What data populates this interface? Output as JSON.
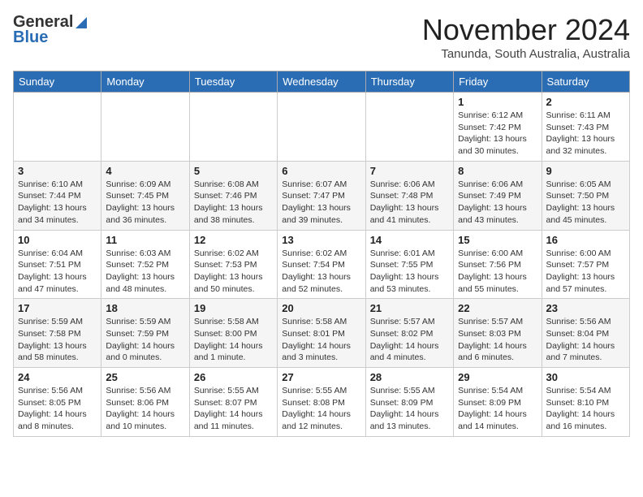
{
  "logo": {
    "general": "General",
    "blue": "Blue"
  },
  "title": "November 2024",
  "location": "Tanunda, South Australia, Australia",
  "days_of_week": [
    "Sunday",
    "Monday",
    "Tuesday",
    "Wednesday",
    "Thursday",
    "Friday",
    "Saturday"
  ],
  "weeks": [
    [
      {
        "day": "",
        "info": ""
      },
      {
        "day": "",
        "info": ""
      },
      {
        "day": "",
        "info": ""
      },
      {
        "day": "",
        "info": ""
      },
      {
        "day": "",
        "info": ""
      },
      {
        "day": "1",
        "info": "Sunrise: 6:12 AM\nSunset: 7:42 PM\nDaylight: 13 hours\nand 30 minutes."
      },
      {
        "day": "2",
        "info": "Sunrise: 6:11 AM\nSunset: 7:43 PM\nDaylight: 13 hours\nand 32 minutes."
      }
    ],
    [
      {
        "day": "3",
        "info": "Sunrise: 6:10 AM\nSunset: 7:44 PM\nDaylight: 13 hours\nand 34 minutes."
      },
      {
        "day": "4",
        "info": "Sunrise: 6:09 AM\nSunset: 7:45 PM\nDaylight: 13 hours\nand 36 minutes."
      },
      {
        "day": "5",
        "info": "Sunrise: 6:08 AM\nSunset: 7:46 PM\nDaylight: 13 hours\nand 38 minutes."
      },
      {
        "day": "6",
        "info": "Sunrise: 6:07 AM\nSunset: 7:47 PM\nDaylight: 13 hours\nand 39 minutes."
      },
      {
        "day": "7",
        "info": "Sunrise: 6:06 AM\nSunset: 7:48 PM\nDaylight: 13 hours\nand 41 minutes."
      },
      {
        "day": "8",
        "info": "Sunrise: 6:06 AM\nSunset: 7:49 PM\nDaylight: 13 hours\nand 43 minutes."
      },
      {
        "day": "9",
        "info": "Sunrise: 6:05 AM\nSunset: 7:50 PM\nDaylight: 13 hours\nand 45 minutes."
      }
    ],
    [
      {
        "day": "10",
        "info": "Sunrise: 6:04 AM\nSunset: 7:51 PM\nDaylight: 13 hours\nand 47 minutes."
      },
      {
        "day": "11",
        "info": "Sunrise: 6:03 AM\nSunset: 7:52 PM\nDaylight: 13 hours\nand 48 minutes."
      },
      {
        "day": "12",
        "info": "Sunrise: 6:02 AM\nSunset: 7:53 PM\nDaylight: 13 hours\nand 50 minutes."
      },
      {
        "day": "13",
        "info": "Sunrise: 6:02 AM\nSunset: 7:54 PM\nDaylight: 13 hours\nand 52 minutes."
      },
      {
        "day": "14",
        "info": "Sunrise: 6:01 AM\nSunset: 7:55 PM\nDaylight: 13 hours\nand 53 minutes."
      },
      {
        "day": "15",
        "info": "Sunrise: 6:00 AM\nSunset: 7:56 PM\nDaylight: 13 hours\nand 55 minutes."
      },
      {
        "day": "16",
        "info": "Sunrise: 6:00 AM\nSunset: 7:57 PM\nDaylight: 13 hours\nand 57 minutes."
      }
    ],
    [
      {
        "day": "17",
        "info": "Sunrise: 5:59 AM\nSunset: 7:58 PM\nDaylight: 13 hours\nand 58 minutes."
      },
      {
        "day": "18",
        "info": "Sunrise: 5:59 AM\nSunset: 7:59 PM\nDaylight: 14 hours\nand 0 minutes."
      },
      {
        "day": "19",
        "info": "Sunrise: 5:58 AM\nSunset: 8:00 PM\nDaylight: 14 hours\nand 1 minute."
      },
      {
        "day": "20",
        "info": "Sunrise: 5:58 AM\nSunset: 8:01 PM\nDaylight: 14 hours\nand 3 minutes."
      },
      {
        "day": "21",
        "info": "Sunrise: 5:57 AM\nSunset: 8:02 PM\nDaylight: 14 hours\nand 4 minutes."
      },
      {
        "day": "22",
        "info": "Sunrise: 5:57 AM\nSunset: 8:03 PM\nDaylight: 14 hours\nand 6 minutes."
      },
      {
        "day": "23",
        "info": "Sunrise: 5:56 AM\nSunset: 8:04 PM\nDaylight: 14 hours\nand 7 minutes."
      }
    ],
    [
      {
        "day": "24",
        "info": "Sunrise: 5:56 AM\nSunset: 8:05 PM\nDaylight: 14 hours\nand 8 minutes."
      },
      {
        "day": "25",
        "info": "Sunrise: 5:56 AM\nSunset: 8:06 PM\nDaylight: 14 hours\nand 10 minutes."
      },
      {
        "day": "26",
        "info": "Sunrise: 5:55 AM\nSunset: 8:07 PM\nDaylight: 14 hours\nand 11 minutes."
      },
      {
        "day": "27",
        "info": "Sunrise: 5:55 AM\nSunset: 8:08 PM\nDaylight: 14 hours\nand 12 minutes."
      },
      {
        "day": "28",
        "info": "Sunrise: 5:55 AM\nSunset: 8:09 PM\nDaylight: 14 hours\nand 13 minutes."
      },
      {
        "day": "29",
        "info": "Sunrise: 5:54 AM\nSunset: 8:09 PM\nDaylight: 14 hours\nand 14 minutes."
      },
      {
        "day": "30",
        "info": "Sunrise: 5:54 AM\nSunset: 8:10 PM\nDaylight: 14 hours\nand 16 minutes."
      }
    ]
  ]
}
